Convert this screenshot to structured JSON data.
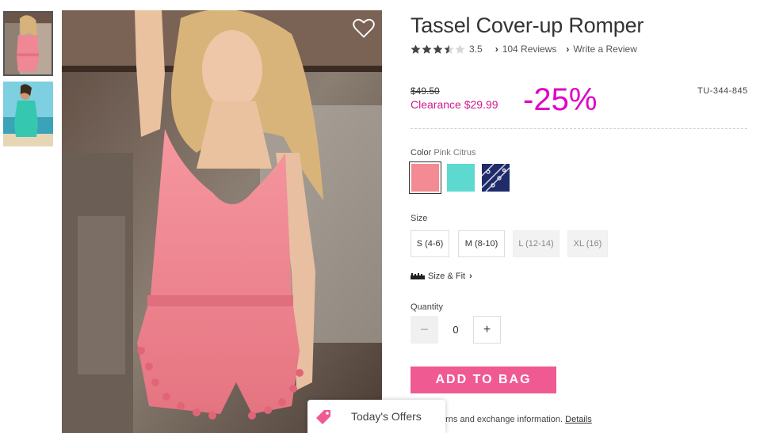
{
  "product": {
    "title": "Tassel Cover-up Romper",
    "rating": "3.5",
    "rating_value": 3.5,
    "reviews_link": "104 Reviews",
    "write_review_link": "Write a Review",
    "old_price": "$49.50",
    "sale_price": "Clearance $29.99",
    "discount": "-25%",
    "sku": "TU-344-845"
  },
  "color": {
    "label": "Color",
    "selected": "Pink Citrus",
    "swatches": [
      "#f28b93",
      "#5ed9cf",
      "#1f2b6a"
    ]
  },
  "size": {
    "label": "Size",
    "options": [
      "S (4-6)",
      "M (8-10)",
      "L (12-14)",
      "XL (16)"
    ]
  },
  "size_fit": "Size & Fit",
  "quantity": {
    "label": "Quantity",
    "minus": "−",
    "value": "0",
    "plus": "+"
  },
  "add_to_bag": "ADD TO BAG",
  "returns": {
    "text": "urns and exchange information.",
    "details": "Details"
  },
  "offers": "Today's Offers",
  "colors": {
    "accent_pink": "#ef5a93",
    "clearance": "#d11a8c",
    "discount": "#e000c8"
  }
}
